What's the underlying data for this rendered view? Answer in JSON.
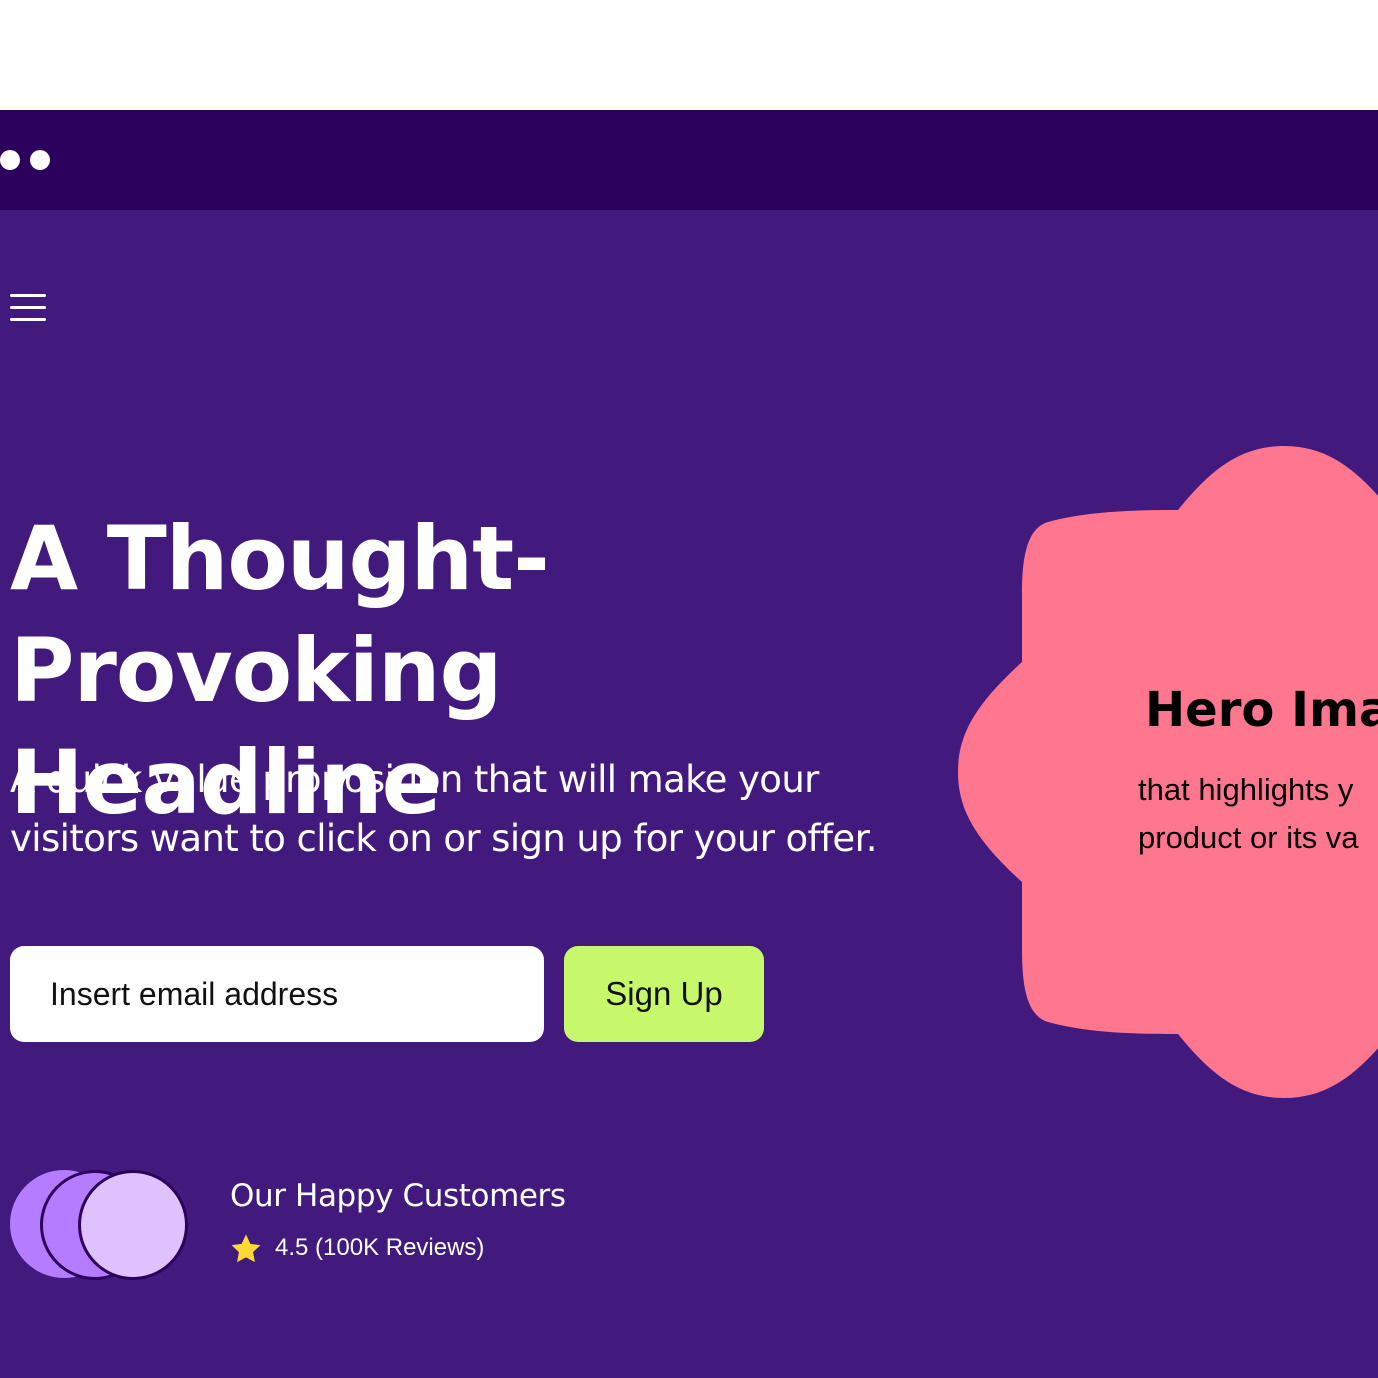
{
  "hero": {
    "headline_line1": "A Thought-",
    "headline_line2": "Provoking Headline",
    "subtext_line1": "A quick value proposition that will make your",
    "subtext_line2": "visitors want to click on or sign up for your offer."
  },
  "signup": {
    "email_placeholder": "Insert email address",
    "button_label": "Sign Up"
  },
  "customers": {
    "title": "Our Happy Customers",
    "rating_text": "4.5 (100K Reviews)"
  },
  "hero_image": {
    "title": "Hero Imag",
    "caption_line1": "that highlights y",
    "caption_line2": "product or its va"
  },
  "colors": {
    "browser_bar": "#2c005d",
    "page_bg": "#421a7e",
    "accent_button": "#c7f86c",
    "hero_blob": "#ff768e",
    "star": "#ffd93b",
    "avatar_purple": "#b57cff",
    "avatar_lilac": "#dfc1fd"
  },
  "icons": {
    "menu": "hamburger-menu-icon",
    "rating": "star-icon"
  }
}
